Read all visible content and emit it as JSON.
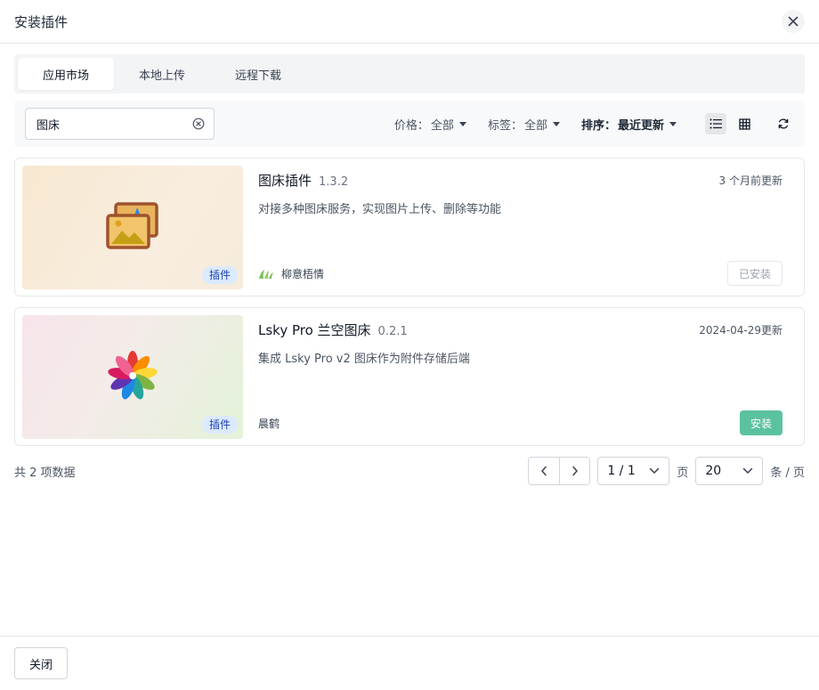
{
  "modal": {
    "title": "安装插件",
    "close_icon": "close-icon"
  },
  "tabs": [
    {
      "label": "应用市场",
      "active": true
    },
    {
      "label": "本地上传",
      "active": false
    },
    {
      "label": "远程下载",
      "active": false
    }
  ],
  "toolbar": {
    "search_value": "图床",
    "clear_icon": "clear-circle-icon",
    "filters": {
      "price": {
        "label": "价格：",
        "value": "全部"
      },
      "tag": {
        "label": "标签：",
        "value": "全部"
      },
      "sort": {
        "label": "排序：",
        "value": "最近更新"
      }
    },
    "view_modes": [
      "list-view-icon",
      "grid-view-icon"
    ],
    "active_view": "list-view-icon",
    "refresh_icon": "refresh-icon"
  },
  "plugins": [
    {
      "name": "图床插件",
      "version": "1.3.2",
      "updated": "3 个月前更新",
      "description": "对接多种图床服务，实现图片上传、删除等功能",
      "type_badge": "插件",
      "author": "柳意梧情",
      "action": "已安装",
      "icon": "image-gallery-icon",
      "accent": "#a0522d"
    },
    {
      "name": "Lsky Pro 兰空图床",
      "version": "0.2.1",
      "updated": "2024-04-29更新",
      "description": "集成 Lsky Pro v2 图床作为附件存储后端",
      "type_badge": "插件",
      "author": "晨鹤",
      "action": "安装",
      "icon": "pinwheel-icon",
      "accent": "#5bc2a0"
    }
  ],
  "pagination": {
    "total_text": "共 2 项数据",
    "page_value": "1 / 1",
    "page_unit": "页",
    "size_value": "20",
    "size_unit": "条 / 页"
  },
  "footer": {
    "close_label": "关闭"
  }
}
